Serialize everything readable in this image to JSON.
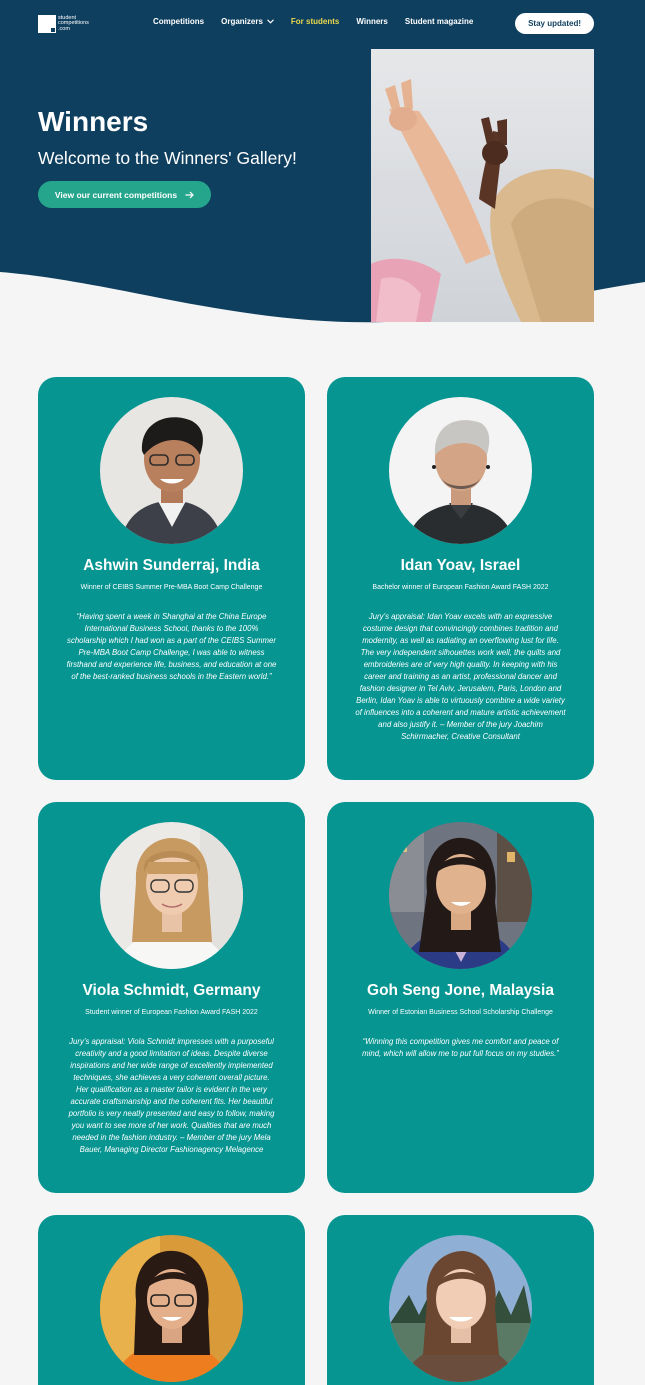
{
  "header": {
    "logo_lines": [
      "student",
      "competitions",
      ".com"
    ],
    "nav": [
      {
        "label": "Competitions",
        "dropdown": false,
        "active": false
      },
      {
        "label": "Organizers",
        "dropdown": true,
        "active": false
      },
      {
        "label": "For students",
        "dropdown": false,
        "active": true
      },
      {
        "label": "Winners",
        "dropdown": false,
        "active": false
      },
      {
        "label": "Student magazine",
        "dropdown": false,
        "active": false
      }
    ],
    "stay_button": "Stay updated!"
  },
  "hero": {
    "title": "Winners",
    "subtitle": "Welcome to the Winners' Gallery!",
    "cta_label": "View our current competitions",
    "cta_icon": "arrow-right-icon"
  },
  "winners": [
    {
      "name": "Ashwin Sunderraj, India",
      "award": "Winner of CEIBS Summer Pre-MBA Boot Camp Challenge",
      "quote": "“Having spent a week in Shanghai at the China Europe International Business School, thanks to the 100% scholarship which I had won as a part of the CEIBS Summer Pre-MBA Boot Camp Challenge, I was able to witness firsthand and experience life, business, and education at one of the best-ranked business schools in the Eastern world.”"
    },
    {
      "name": "Idan Yoav, Israel",
      "award": "Bachelor winner of European Fashion Award FASH 2022",
      "quote": "Jury’s appraisal: Idan Yoav excels with an expressive costume design that convincingly combines tradition and modernity, as well as radiating an overflowing lust for life. The very independent silhouettes work well, the quilts and embroideries are of very high quality. In keeping with his career and training as an artist, professional dancer and fashion designer in Tel Aviv, Jerusalem, Paris, London and Berlin, Idan Yoav is able to virtuously combine a wide variety of influences into a coherent and mature artistic achievement and also justify it. – Member of the jury Joachim Schirrmacher, Creative Consultant"
    },
    {
      "name": "Viola Schmidt, Germany",
      "award": "Student winner of European Fashion Award FASH 2022",
      "quote": "Jury’s appraisal: Viola Schmidt impresses with a purposeful creativity and a good limitation of ideas. Despite diverse inspirations and her wide range of excellently implemented techniques, she achieves a very coherent overall picture. Her qualification as a master tailor is evident in the very accurate craftsmanship and the coherent fits. Her beautiful portfolio is very neatly presented and easy to follow, making you want to see more of her work. Qualities that are much needed in the fashion industry. – Member of the jury Mela Bauer, Managing Director Fashionagency Melagence"
    },
    {
      "name": "Goh Seng Jone, Malaysia",
      "award": "Winner of Estonian Business School Scholarship Challenge",
      "quote": "“Winning this competition gives me comfort and peace of mind, which will allow me to put full focus on my studies.”"
    },
    {
      "name": "",
      "award": "",
      "quote": ""
    },
    {
      "name": "",
      "award": "",
      "quote": ""
    }
  ],
  "colors": {
    "hero_bg": "#0e3f5f",
    "card_bg": "#069591",
    "cta_bg": "#25a58c",
    "active_nav": "#e9d84c",
    "page_bg": "#f5f5f5"
  }
}
